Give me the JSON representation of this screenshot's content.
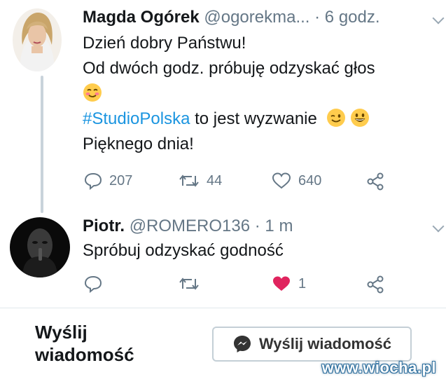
{
  "tweet1": {
    "name": "Magda Ogórek",
    "handle": "@ogorekma...",
    "time": "· 6 godz.",
    "line1": "Dzień dobry Państwu!",
    "line2": "Od dwóch godz. próbuję odzyskać głos",
    "hashtag": "#StudioPolska",
    "line4_rest": " to jest wyzwanie",
    "line5": "Pięknego dnia!",
    "replies": "207",
    "retweets": "44",
    "likes": "640",
    "avatar_icon": "woman-avatar-icon"
  },
  "tweet2": {
    "name": "Piotr.",
    "handle": "@ROMERO136",
    "time": "· 1 m",
    "text": "Spróbuj odzyskać godność",
    "likes": "1",
    "avatar_icon": "dark-hooded-figure-avatar-icon"
  },
  "footer": {
    "title": "Wyślij\nwiadomość",
    "button_label": "Wyślij wiadomość"
  },
  "watermark": "www.wiocha.pl",
  "colors": {
    "hashtag": "#1b95e0",
    "meta": "#657786",
    "like_active": "#e0245e",
    "thread_line": "#c9d3db"
  }
}
